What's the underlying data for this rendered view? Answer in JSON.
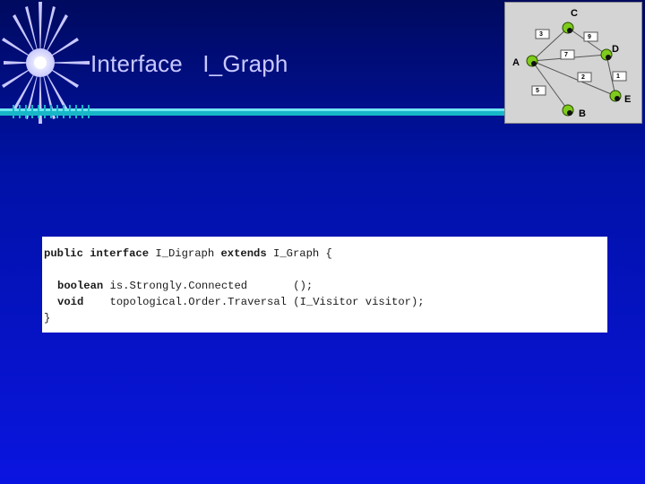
{
  "slide": {
    "title": "Interface   I_Graph"
  },
  "graph": {
    "nodes": [
      {
        "id": "C",
        "label": "C"
      },
      {
        "id": "D",
        "label": "D"
      },
      {
        "id": "A",
        "label": "A"
      },
      {
        "id": "E",
        "label": "E"
      },
      {
        "id": "B",
        "label": "B"
      }
    ],
    "weights": [
      {
        "from": "A",
        "to": "C",
        "label": "3"
      },
      {
        "from": "C",
        "to": "D",
        "label": "9"
      },
      {
        "from": "A",
        "to": "D",
        "label": "7"
      },
      {
        "from": "A",
        "to": "E",
        "label": "2"
      },
      {
        "from": "D",
        "to": "E",
        "label": "1"
      },
      {
        "from": "A",
        "to": "B",
        "label": "5"
      }
    ],
    "node_color": "#7ecb1c"
  },
  "code": {
    "line1": {
      "kw1": "public interface",
      "text1": " I_Digraph ",
      "kw2": "extends",
      "text2": " I_Graph {"
    },
    "line2": {
      "kw": "boolean",
      "text": " is.Strongly.Connected       ();"
    },
    "line3": {
      "kw": "void",
      "text": "    topological.Order.Traversal (I_Visitor visitor);"
    },
    "line4": {
      "text": "}"
    }
  }
}
